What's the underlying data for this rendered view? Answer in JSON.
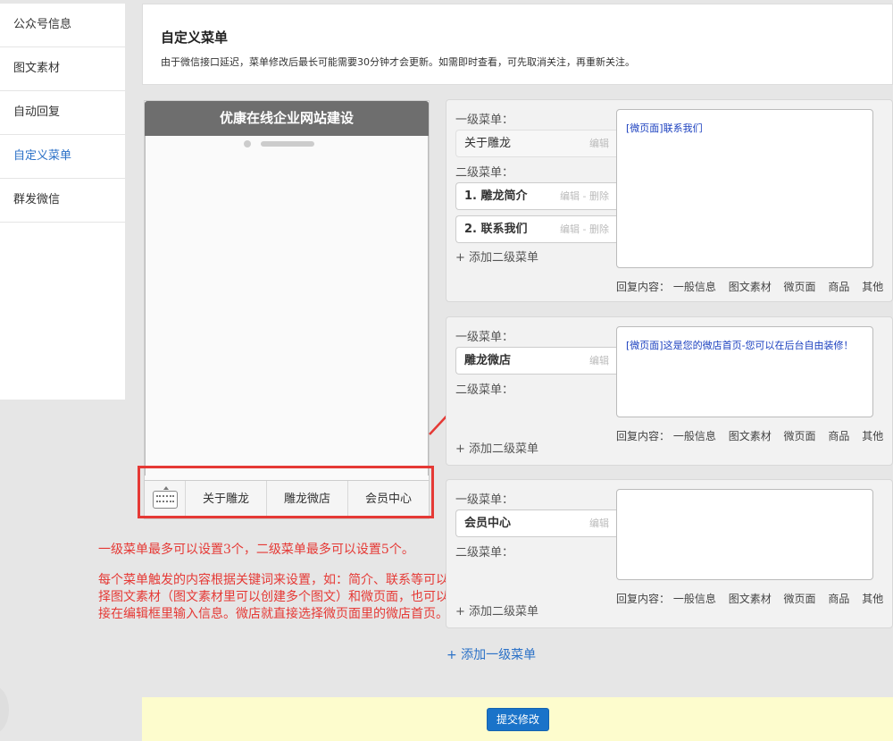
{
  "sidebar": {
    "items": [
      {
        "label": "公众号信息"
      },
      {
        "label": "图文素材"
      },
      {
        "label": "自动回复"
      },
      {
        "label": "自定义菜单"
      },
      {
        "label": "群发微信"
      }
    ],
    "active_index": 3
  },
  "header": {
    "title": "自定义菜单",
    "desc": "由于微信接口延迟，菜单修改后最长可能需要30分钟才会更新。如需即时查看，可先取消关注，再重新关注。"
  },
  "phone": {
    "title": "优康在线企业网站建设",
    "menu": [
      "关于雕龙",
      "雕龙微店",
      "会员中心"
    ]
  },
  "annotations": {
    "note1": "一级菜单最多可以设置3个，二级菜单最多可以设置5个。",
    "note2": "每个菜单触发的内容根据关键词来设置，如：简介、联系等可以选择图文素材（图文素材里可以创建多个图文）和微页面，也可以直接在编辑框里输入信息。微店就直接选择微页面里的微店首页。"
  },
  "labels": {
    "first_level": "一级菜单：",
    "second_level": "二级菜单：",
    "edit": "编辑",
    "edit_delete": "编辑 - 删除",
    "add_sub": "+ 添加二级菜单",
    "reply_prefix": "回复内容：",
    "reply_options": [
      "一般信息",
      "图文素材",
      "微页面",
      "商品",
      "其他"
    ]
  },
  "menus": [
    {
      "name": "关于雕龙",
      "subs": [
        "1. 雕龙简介",
        "2. 联系我们"
      ],
      "content": "[微页面]联系我们"
    },
    {
      "name": "雕龙微店",
      "subs": [],
      "content": "[微页面]这是您的微店首页-您可以在后台自由装修！"
    },
    {
      "name": "会员中心",
      "subs": [],
      "content": ""
    }
  ],
  "add_first_label": "+ 添加一级菜单",
  "submit_label": "提交修改"
}
